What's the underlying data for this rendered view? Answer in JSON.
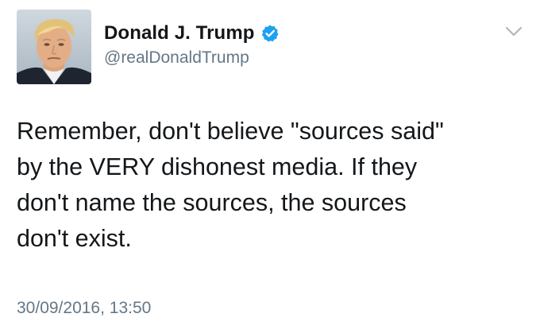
{
  "tweet": {
    "author": {
      "display_name": "Donald J. Trump",
      "handle": "@realDonaldTrump",
      "verified_icon": "verified-badge-icon",
      "avatar_icon": "profile-photo"
    },
    "text": "Remember, don't believe \"sources said\"\nby the VERY dishonest media. If they\ndon't name the sources, the sources\ndon't exist.",
    "timestamp": "30/09/2016, 13:50",
    "menu_icon": "chevron-down-icon"
  },
  "colors": {
    "text_primary": "#14171a",
    "text_secondary": "#657786",
    "verified_blue": "#1da1f2",
    "caret_gray": "#aab8c2"
  }
}
